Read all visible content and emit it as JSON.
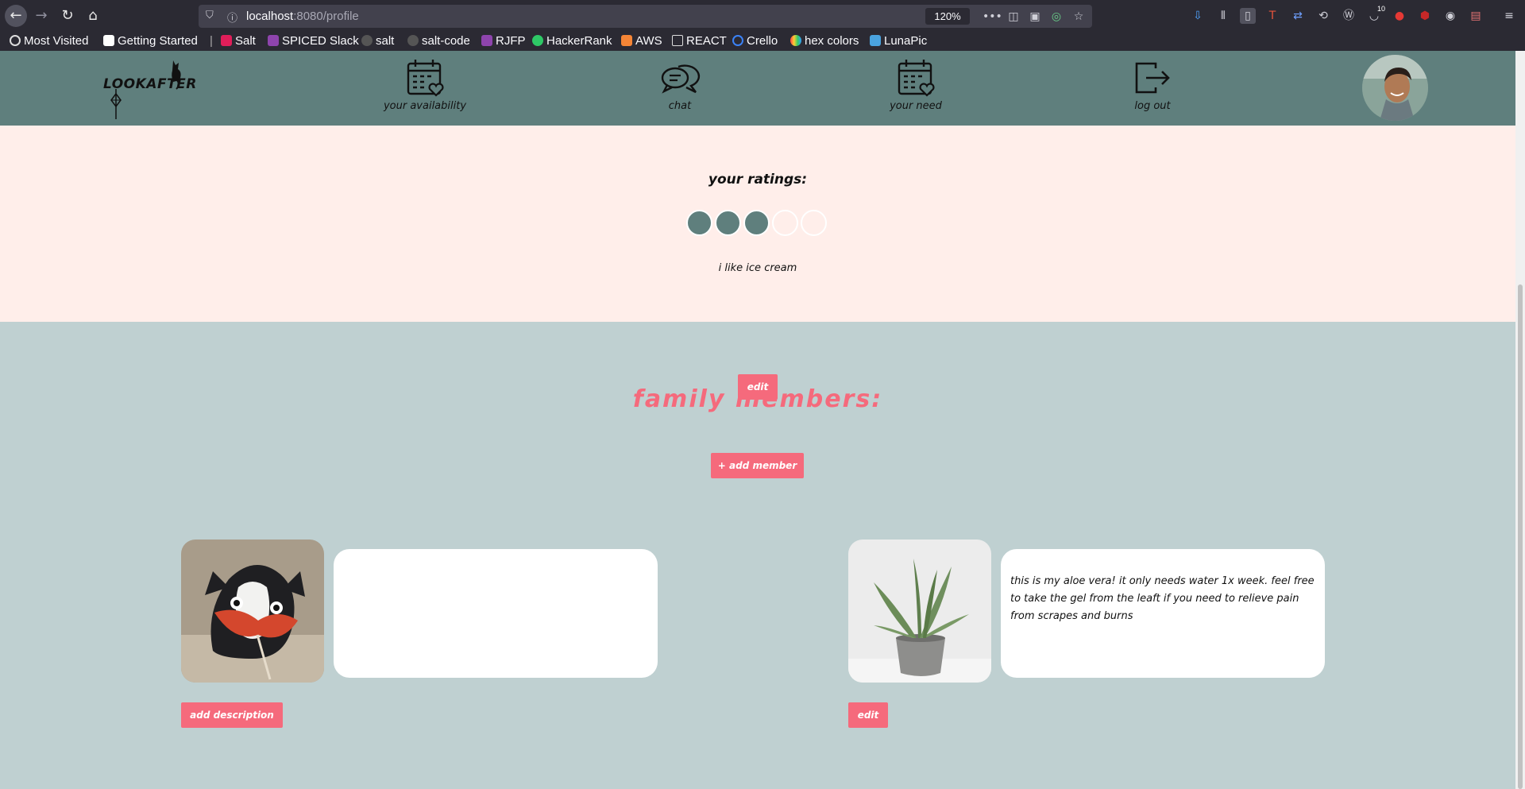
{
  "browser": {
    "url_host": "localhost",
    "url_path": ":8080/profile",
    "zoom": "120%",
    "bookmarks": [
      "Most Visited",
      "Getting Started",
      "|",
      "Salt",
      "SPICED Slack",
      "salt",
      "salt-code",
      "RJFP",
      "HackerRank",
      "AWS",
      "REACT",
      "Crello",
      "hex colors",
      "LunaPic"
    ],
    "badge_count": "10"
  },
  "header": {
    "logo": "LOOKAFTER",
    "nav": {
      "availability": "your availability",
      "chat": "chat",
      "need": "your need",
      "logout": "log out"
    }
  },
  "ratings": {
    "title": "your ratings:",
    "value": 3,
    "max": 5,
    "bio": "i like ice cream",
    "edit_label": "edit"
  },
  "family": {
    "title": "family members:",
    "add_label": "+ add member",
    "members": [
      {
        "photo": "dog-photo",
        "description": "",
        "action_label": "add description"
      },
      {
        "photo": "aloe-plant-photo",
        "description": "this is my aloe vera! it only needs water 1x week. feel free to take the gel from the leaft if you need to relieve pain from scrapes and burns",
        "action_label": "edit"
      }
    ]
  },
  "colors": {
    "header_bg": "#5f7f7d",
    "ratings_bg": "#ffeeea",
    "family_bg": "#bfd0d1",
    "accent_pink": "#f56a7c"
  }
}
